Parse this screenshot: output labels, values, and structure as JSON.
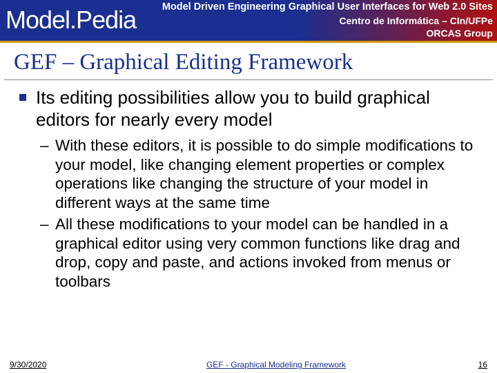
{
  "header": {
    "logo": "Model.Pedia",
    "top_line": "Model Driven Engineering Graphical User Interfaces for Web 2.0 Sites",
    "sub_line_1": "Centro de Informática – CIn/UFPe",
    "sub_line_2": "ORCAS Group"
  },
  "title": "GEF – Graphical Editing Framework",
  "body": {
    "bullet_1": "Its editing possibilities allow you to build graphical editors for nearly every model",
    "sub_bullet_1": "With these editors, it is possible to do simple modifications to your model, like changing element properties or complex operations like changing the structure of your model in different ways at the same time",
    "sub_bullet_2": "All these modifications to your model can be handled in a graphical editor using very common functions like drag and drop, copy and paste, and actions invoked from menus or toolbars"
  },
  "footer": {
    "date": "9/30/2020",
    "middle": "GEF - Graphical Modeling Framework",
    "page": "16"
  }
}
